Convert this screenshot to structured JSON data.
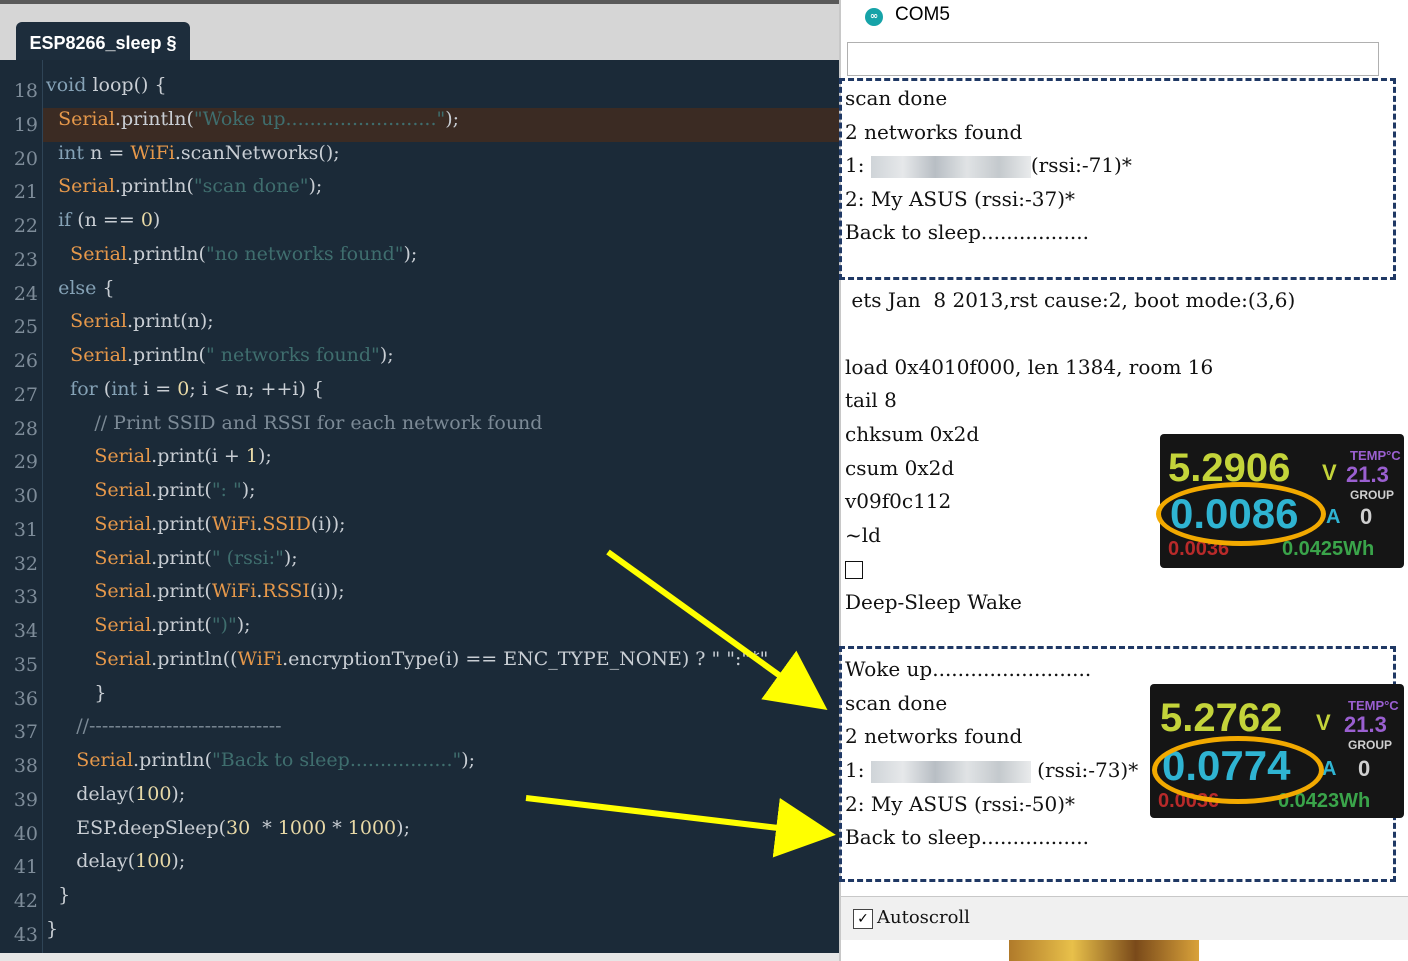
{
  "editor": {
    "tab_label": "ESP8266_sleep §",
    "highlighted_line": 19,
    "lines": [
      {
        "n": "18",
        "segs": [
          {
            "c": "type",
            "t": "void"
          },
          {
            "c": "fn",
            "t": " loop() {"
          }
        ]
      },
      {
        "n": "19",
        "segs": [
          {
            "c": "fn",
            "t": "  "
          },
          {
            "c": "obj",
            "t": "Serial"
          },
          {
            "c": "fn",
            "t": ".println("
          },
          {
            "c": "str",
            "t": "\"Woke up.........................\""
          },
          {
            "c": "fn",
            "t": ");"
          }
        ]
      },
      {
        "n": "20",
        "segs": [
          {
            "c": "fn",
            "t": "  "
          },
          {
            "c": "type",
            "t": "int"
          },
          {
            "c": "fn",
            "t": " n = "
          },
          {
            "c": "obj",
            "t": "WiFi"
          },
          {
            "c": "fn",
            "t": ".scanNetworks();"
          }
        ]
      },
      {
        "n": "21",
        "segs": [
          {
            "c": "fn",
            "t": "  "
          },
          {
            "c": "obj",
            "t": "Serial"
          },
          {
            "c": "fn",
            "t": ".println("
          },
          {
            "c": "str",
            "t": "\"scan done\""
          },
          {
            "c": "fn",
            "t": ");"
          }
        ]
      },
      {
        "n": "22",
        "segs": [
          {
            "c": "fn",
            "t": "  "
          },
          {
            "c": "type",
            "t": "if"
          },
          {
            "c": "fn",
            "t": " (n == "
          },
          {
            "c": "num",
            "t": "0"
          },
          {
            "c": "fn",
            "t": ")"
          }
        ]
      },
      {
        "n": "23",
        "segs": [
          {
            "c": "fn",
            "t": "    "
          },
          {
            "c": "obj",
            "t": "Serial"
          },
          {
            "c": "fn",
            "t": ".println("
          },
          {
            "c": "str",
            "t": "\"no networks found\""
          },
          {
            "c": "fn",
            "t": ");"
          }
        ]
      },
      {
        "n": "24",
        "segs": [
          {
            "c": "fn",
            "t": "  "
          },
          {
            "c": "type",
            "t": "else"
          },
          {
            "c": "fn",
            "t": " {"
          }
        ]
      },
      {
        "n": "25",
        "segs": [
          {
            "c": "fn",
            "t": "    "
          },
          {
            "c": "obj",
            "t": "Serial"
          },
          {
            "c": "fn",
            "t": ".print(n);"
          }
        ]
      },
      {
        "n": "26",
        "segs": [
          {
            "c": "fn",
            "t": "    "
          },
          {
            "c": "obj",
            "t": "Serial"
          },
          {
            "c": "fn",
            "t": ".println("
          },
          {
            "c": "str",
            "t": "\" networks found\""
          },
          {
            "c": "fn",
            "t": ");"
          }
        ]
      },
      {
        "n": "27",
        "segs": [
          {
            "c": "fn",
            "t": "    "
          },
          {
            "c": "type",
            "t": "for"
          },
          {
            "c": "fn",
            "t": " ("
          },
          {
            "c": "type",
            "t": "int"
          },
          {
            "c": "fn",
            "t": " i = "
          },
          {
            "c": "num",
            "t": "0"
          },
          {
            "c": "fn",
            "t": "; i < n; ++i) {"
          }
        ]
      },
      {
        "n": "28",
        "segs": [
          {
            "c": "fn",
            "t": "        "
          },
          {
            "c": "com",
            "t": "// Print SSID and RSSI for each network found"
          }
        ]
      },
      {
        "n": "29",
        "segs": [
          {
            "c": "fn",
            "t": "        "
          },
          {
            "c": "obj",
            "t": "Serial"
          },
          {
            "c": "fn",
            "t": ".print(i + "
          },
          {
            "c": "num",
            "t": "1"
          },
          {
            "c": "fn",
            "t": ");"
          }
        ]
      },
      {
        "n": "30",
        "segs": [
          {
            "c": "fn",
            "t": "        "
          },
          {
            "c": "obj",
            "t": "Serial"
          },
          {
            "c": "fn",
            "t": ".print("
          },
          {
            "c": "str",
            "t": "\": \""
          },
          {
            "c": "fn",
            "t": ");"
          }
        ]
      },
      {
        "n": "31",
        "segs": [
          {
            "c": "fn",
            "t": "        "
          },
          {
            "c": "obj",
            "t": "Serial"
          },
          {
            "c": "fn",
            "t": ".print("
          },
          {
            "c": "obj",
            "t": "WiFi"
          },
          {
            "c": "fn",
            "t": "."
          },
          {
            "c": "obj",
            "t": "SSID"
          },
          {
            "c": "fn",
            "t": "(i));"
          }
        ]
      },
      {
        "n": "32",
        "segs": [
          {
            "c": "fn",
            "t": "        "
          },
          {
            "c": "obj",
            "t": "Serial"
          },
          {
            "c": "fn",
            "t": ".print("
          },
          {
            "c": "str",
            "t": "\" (rssi:\""
          },
          {
            "c": "fn",
            "t": ");"
          }
        ]
      },
      {
        "n": "33",
        "segs": [
          {
            "c": "fn",
            "t": "        "
          },
          {
            "c": "obj",
            "t": "Serial"
          },
          {
            "c": "fn",
            "t": ".print("
          },
          {
            "c": "obj",
            "t": "WiFi"
          },
          {
            "c": "fn",
            "t": "."
          },
          {
            "c": "obj",
            "t": "RSSI"
          },
          {
            "c": "fn",
            "t": "(i));"
          }
        ]
      },
      {
        "n": "34",
        "segs": [
          {
            "c": "fn",
            "t": "        "
          },
          {
            "c": "obj",
            "t": "Serial"
          },
          {
            "c": "fn",
            "t": ".print("
          },
          {
            "c": "str",
            "t": "\")\""
          },
          {
            "c": "fn",
            "t": ");"
          }
        ]
      },
      {
        "n": "35",
        "segs": [
          {
            "c": "fn",
            "t": "        "
          },
          {
            "c": "obj",
            "t": "Serial"
          },
          {
            "c": "fn",
            "t": ".println(("
          },
          {
            "c": "obj",
            "t": "WiFi"
          },
          {
            "c": "fn",
            "t": ".encryptionType(i) == ENC_TYPE_NONE) ? \" \":\"*\""
          }
        ]
      },
      {
        "n": "36",
        "segs": [
          {
            "c": "fn",
            "t": "        }"
          }
        ]
      },
      {
        "n": "37",
        "segs": [
          {
            "c": "fn",
            "t": "     "
          },
          {
            "c": "com",
            "t": "//------------------------------"
          }
        ]
      },
      {
        "n": "38",
        "segs": [
          {
            "c": "fn",
            "t": "     "
          },
          {
            "c": "obj",
            "t": "Serial"
          },
          {
            "c": "fn",
            "t": ".println("
          },
          {
            "c": "str",
            "t": "\"Back to sleep.................\""
          },
          {
            "c": "fn",
            "t": ");"
          }
        ]
      },
      {
        "n": "39",
        "segs": [
          {
            "c": "fn",
            "t": "     delay("
          },
          {
            "c": "num",
            "t": "100"
          },
          {
            "c": "fn",
            "t": ");"
          }
        ]
      },
      {
        "n": "40",
        "segs": [
          {
            "c": "fn",
            "t": "     ESP.deepSleep("
          },
          {
            "c": "num",
            "t": "30"
          },
          {
            "c": "fn",
            "t": "  * "
          },
          {
            "c": "num",
            "t": "1000"
          },
          {
            "c": "fn",
            "t": " * "
          },
          {
            "c": "num",
            "t": "1000"
          },
          {
            "c": "fn",
            "t": ");"
          }
        ]
      },
      {
        "n": "41",
        "segs": [
          {
            "c": "fn",
            "t": "     delay("
          },
          {
            "c": "num",
            "t": "100"
          },
          {
            "c": "fn",
            "t": ");"
          }
        ]
      },
      {
        "n": "42",
        "segs": [
          {
            "c": "fn",
            "t": "  }"
          }
        ]
      },
      {
        "n": "43",
        "segs": [
          {
            "c": "fn",
            "t": "}"
          }
        ]
      }
    ]
  },
  "monitor": {
    "title": "COM5",
    "logo_glyph": "∞",
    "input_value": "",
    "autoscroll_label": "Autoscroll",
    "autoscroll_checked_glyph": "✓",
    "checkbox_glyph": "",
    "lines": [
      {
        "t": "scan done"
      },
      {
        "t": "2 networks found"
      },
      {
        "t": "1: ",
        "blur": true,
        "after": "(rssi:-71)*"
      },
      {
        "t": "2: My ASUS (rssi:-37)*"
      },
      {
        "t": "Back to sleep................."
      },
      {
        "t": ""
      },
      {
        "t": " ets Jan  8 2013,rst cause:2, boot mode:(3,6)"
      },
      {
        "t": ""
      },
      {
        "t": "load 0x4010f000, len 1384, room 16"
      },
      {
        "t": "tail 8"
      },
      {
        "t": "chksum 0x2d"
      },
      {
        "t": "csum 0x2d"
      },
      {
        "t": "v09f0c112"
      },
      {
        "t": "~ld"
      },
      {
        "t": "",
        "box": true
      },
      {
        "t": "Deep-Sleep Wake"
      },
      {
        "t": ""
      },
      {
        "t": "Woke up........................."
      },
      {
        "t": "scan done"
      },
      {
        "t": "2 networks found"
      },
      {
        "t": "1: ",
        "blur": true,
        "after": " (rssi:-73)*"
      },
      {
        "t": "2: My ASUS (rssi:-50)*"
      },
      {
        "t": "Back to sleep................."
      }
    ]
  },
  "meters": [
    {
      "voltage": "5.2906",
      "v_unit": "V",
      "current": "0.0086",
      "a_unit": "A",
      "temp_label": "TEMP°C",
      "temp": "21.3",
      "group_label": "GROUP",
      "group": "0",
      "energy": "0.0425Wh",
      "red": "0.0036"
    },
    {
      "voltage": "5.2762",
      "v_unit": "V",
      "current": "0.0774",
      "a_unit": "A",
      "temp_label": "TEMP°C",
      "temp": "21.3",
      "group_label": "GROUP",
      "group": "0",
      "energy": "0.0423Wh",
      "red": "0.0036"
    }
  ],
  "colors": {
    "editor_bg": "#1b2a38",
    "highlight": "#3b2b23",
    "keyword": "#85a2b6",
    "object": "#e6984a",
    "string": "#3f6e6e",
    "number": "#e8d9a7",
    "dash_box": "#1f3864",
    "arrow": "#ffff00",
    "ring": "#f2a900"
  }
}
